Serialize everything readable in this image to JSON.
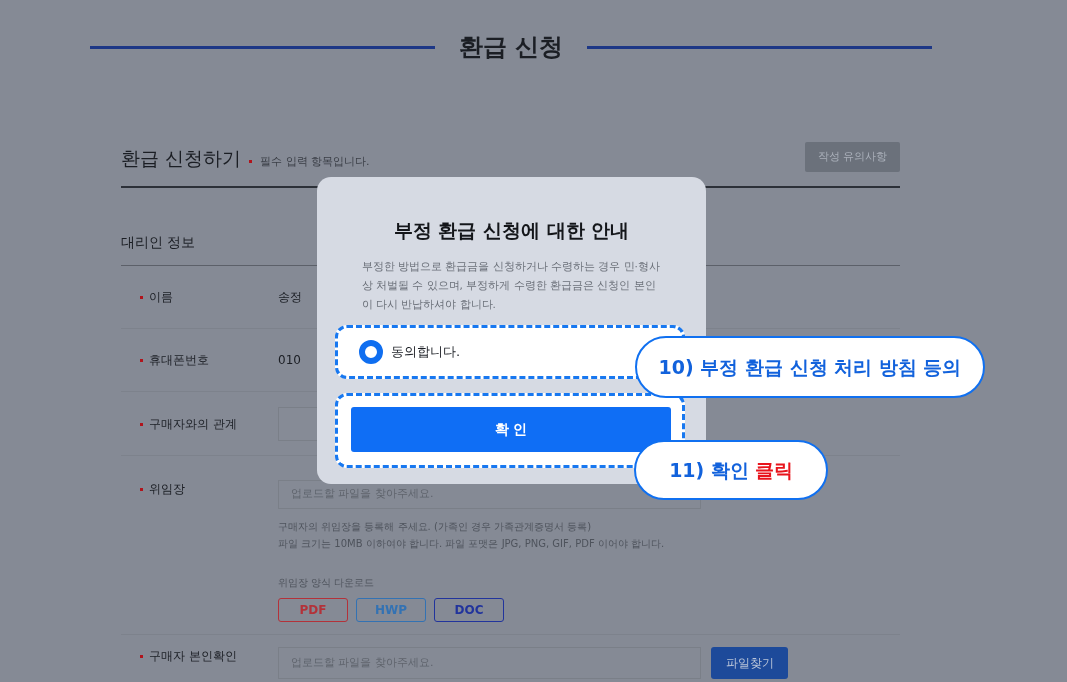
{
  "header": {
    "title": "환급 신청"
  },
  "form": {
    "title": "환급 신청하기",
    "required_note": "필수 입력 항목입니다.",
    "notice_button": "작성 유의사항",
    "section": "대리인 정보",
    "rows": [
      {
        "kind": "text",
        "label": "이름",
        "value": "송정"
      },
      {
        "kind": "text",
        "label": "휴대폰번호",
        "value": "010"
      },
      {
        "kind": "select",
        "label": "구매자와의 관계"
      },
      {
        "kind": "upload",
        "label": "위임장",
        "placeholder": "업로드할 파일을 찾아주세요.",
        "help": [
          "구매자의 위임장을 등록해 주세요. (가족인 경우 가족관계증명서 등록)",
          "파일 크기는 10MB 이하여야 합니다. 파일 포맷은 JPG, PNG, GIF, PDF 이어야 합니다."
        ],
        "download_label": "위임장 양식 다운로드",
        "downloads": [
          {
            "label": "PDF",
            "color": "#b3323a"
          },
          {
            "label": "HWP",
            "color": "#3372b3"
          },
          {
            "label": "DOC",
            "color": "#22349c"
          }
        ]
      },
      {
        "kind": "upload",
        "label": "구매자 본인확인",
        "placeholder": "업로드할 파일을 찾아주세요.",
        "button": "파일찾기"
      }
    ]
  },
  "modal": {
    "title": "부정 환급 신청에 대한 안내",
    "body": "부정한 방법으로 환급금을 신청하거나 수령하는 경우 민·형사상 처벌될 수 있으며, 부정하게 수령한 환급금은 신청인 본인이 다시 반납하셔야 합니다.",
    "agree": {
      "label": "동의합니다.",
      "selected": true
    },
    "confirm": "확 인"
  },
  "callouts": [
    {
      "text": "10) 부정 환급 신청 처리 방침 등의"
    },
    {
      "text": "11) 확인",
      "highlight": "클릭"
    }
  ]
}
